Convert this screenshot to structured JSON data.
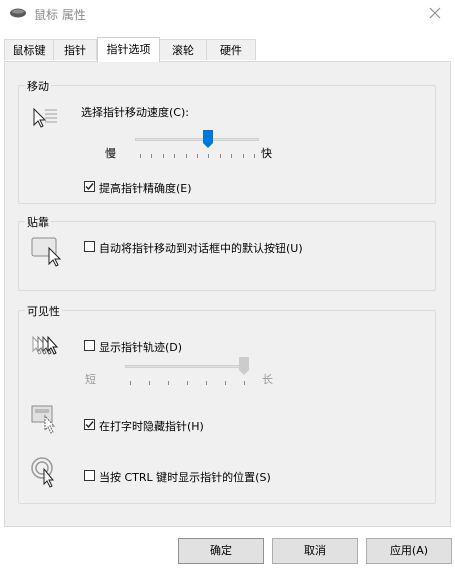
{
  "window": {
    "title": "鼠标 属性",
    "close_icon": "close-icon",
    "app_icon": "mouse-icon"
  },
  "tabs": [
    {
      "label": "鼠标键",
      "active": false
    },
    {
      "label": "指针",
      "active": false
    },
    {
      "label": "指针选项",
      "active": true
    },
    {
      "label": "滚轮",
      "active": false
    },
    {
      "label": "硬件",
      "active": false
    }
  ],
  "motion": {
    "title": "移动",
    "speed_label": "选择指针移动速度(C):",
    "slow_label": "慢",
    "fast_label": "快",
    "speed_level": 0.6,
    "enhance_precision": {
      "label": "提高指针精确度(E)",
      "checked": true
    }
  },
  "snap_to": {
    "title": "贴靠",
    "auto_snap": {
      "label": "自动将指针移动到对话框中的默认按钮(U)",
      "checked": false
    }
  },
  "visibility": {
    "title": "可见性",
    "pointer_trails": {
      "label": "显示指针轨迹(D)",
      "checked": false
    },
    "short_label": "短",
    "long_label": "长",
    "trail_level": 1.0,
    "hide_while_typing": {
      "label": "在打字时隐藏指针(H)",
      "checked": true
    },
    "show_location_ctrl": {
      "label": "当按 CTRL 键时显示指针的位置(S)",
      "checked": false
    }
  },
  "buttons": {
    "ok": "确定",
    "cancel": "取消",
    "apply": "应用(A)"
  },
  "colors": {
    "accent": "#0078d7",
    "panel_bg": "#f0f0f0"
  }
}
